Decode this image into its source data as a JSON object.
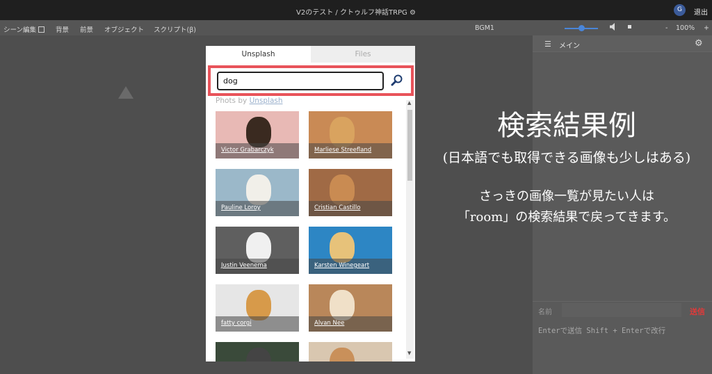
{
  "titlebar": {
    "title": "V2のテスト / クトゥルフ神話TRPG ⚙",
    "avatar": "G",
    "exit_label": "退出"
  },
  "menubar": {
    "scene_edit": "シーン編集",
    "background": "背景",
    "foreground": "前景",
    "objects": "オブジェクト",
    "script": "スクリプト(β)",
    "bgm": "BGM1",
    "volume_icon": "speaker-icon",
    "zoom": "100%",
    "zoom_minus": "-",
    "zoom_plus": "+"
  },
  "chat": {
    "channel": "メイン",
    "name_label": "名前",
    "send_label": "送信",
    "input_hint": "Enterで送信 Shift + Enterで改行"
  },
  "annotation": {
    "title": "検索結果例",
    "subtitle": "(日本語でも取得できる画像も少しはある)",
    "line1": "さっきの画像一覧が見たい人は",
    "line2": "「room」の検索結果で戻ってきます。"
  },
  "dialog": {
    "tab_unsplash": "Unsplash",
    "tab_files": "Files",
    "search_value": "dog",
    "credit_prefix": "Phots by ",
    "credit_link": "Unsplash",
    "photos": [
      {
        "photographer": "Victor Grabarczyk",
        "bg": "#e8b9b5"
      },
      {
        "photographer": "Marliese Streefland",
        "bg": "#c98a55"
      },
      {
        "photographer": "Pauline Loroy",
        "bg": "#9bb8c9"
      },
      {
        "photographer": "Cristian Castillo",
        "bg": "#a06a45"
      },
      {
        "photographer": "Justin Veenema",
        "bg": "#5f5f5f"
      },
      {
        "photographer": "Karsten Winegeart",
        "bg": "#2d86c4"
      },
      {
        "photographer": "fatty corgi",
        "bg": "#e6e6e6"
      },
      {
        "photographer": "Alvan Nee",
        "bg": "#b9875a"
      },
      {
        "photographer": "",
        "bg": "#3a4a3a"
      },
      {
        "photographer": "",
        "bg": "#d9c7b0"
      }
    ]
  }
}
